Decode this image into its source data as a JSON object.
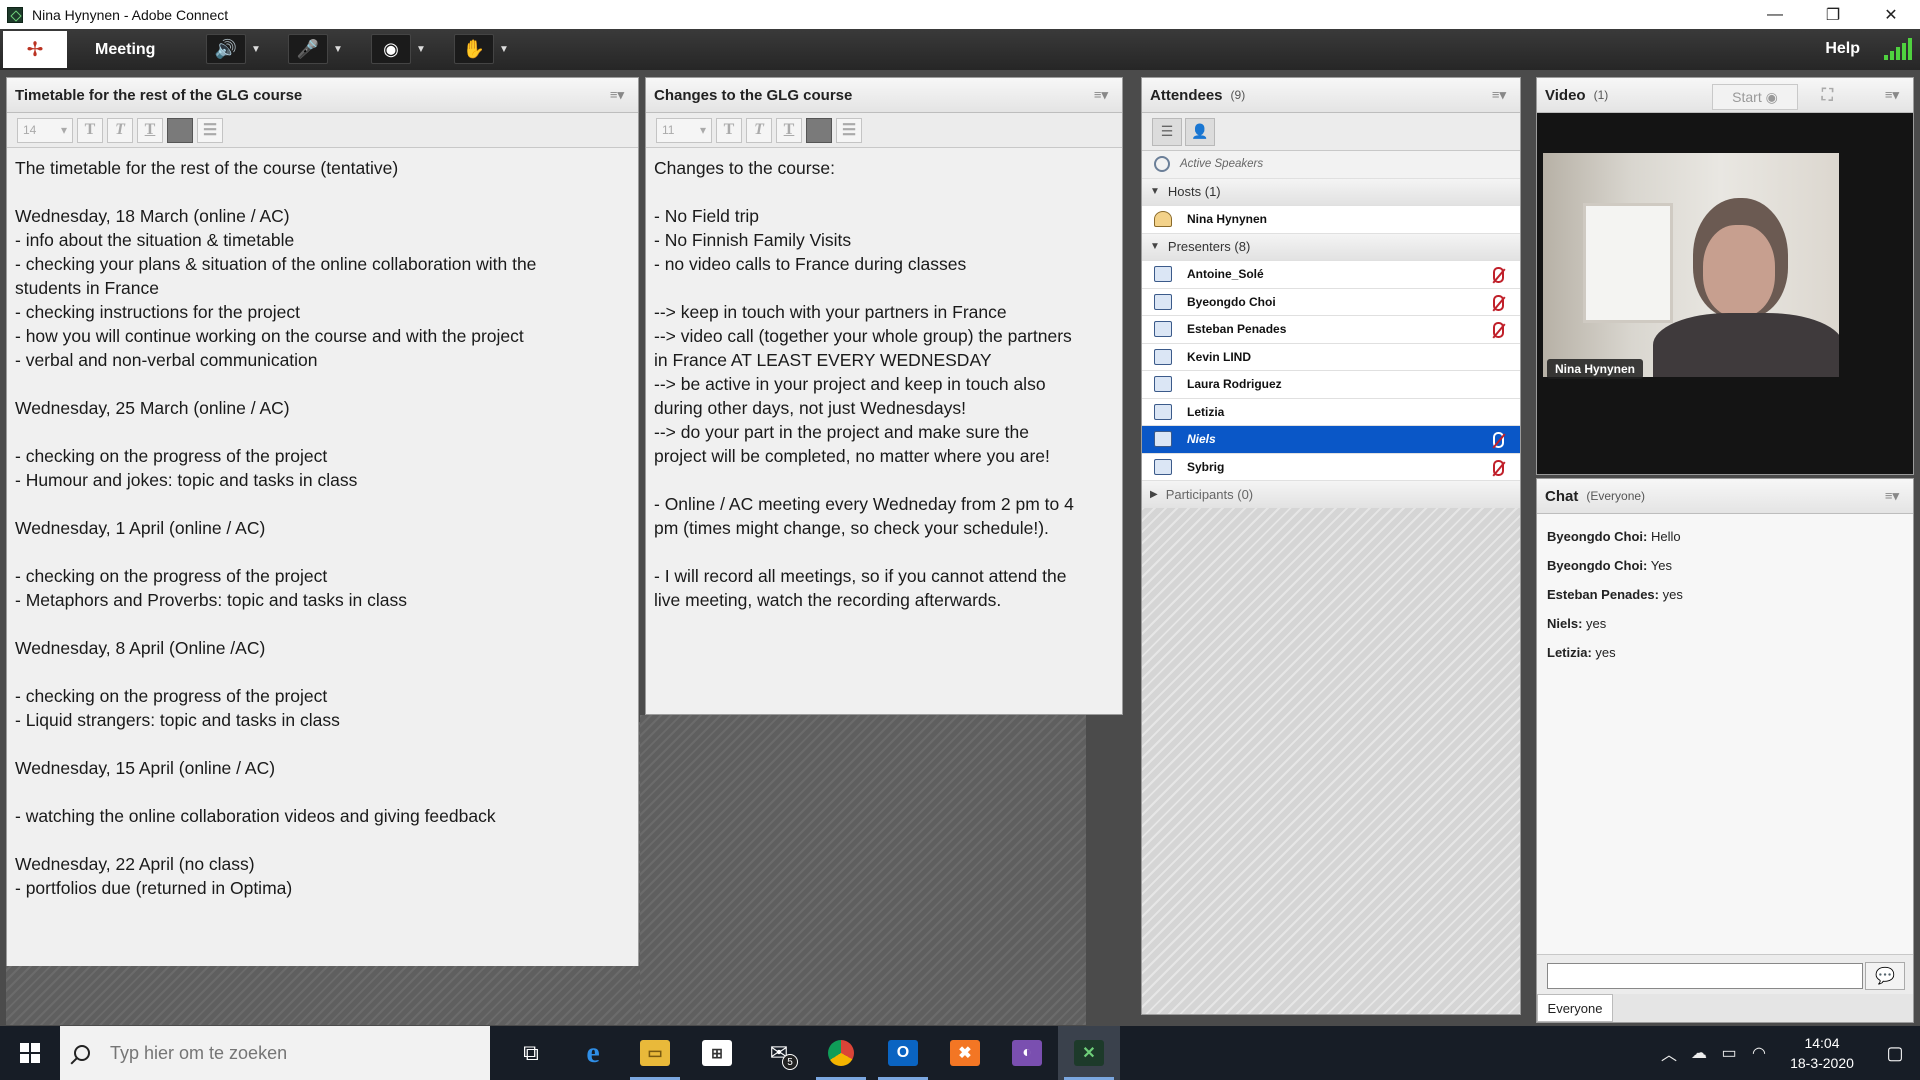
{
  "window": {
    "title": "Nina Hynynen - Adobe Connect",
    "controls": [
      "—",
      "❐",
      "✕"
    ]
  },
  "toolbar": {
    "meeting_label": "Meeting",
    "help_label": "Help"
  },
  "timetable_pod": {
    "title": "Timetable for the rest of the GLG course",
    "font_size": "14",
    "lines": [
      "The timetable for the rest of the course (tentative)",
      "",
      "Wednesday, 18 March (online / AC)",
      "- info about the situation & timetable",
      "- checking your plans & situation of the online collaboration with the",
      "students in France",
      "- checking instructions for the project",
      "- how you will continue working on the course and with the project",
      "- verbal and non-verbal communication",
      "",
      "Wednesday, 25 March (online / AC)",
      "",
      "- checking on the progress of the project",
      "- Humour and jokes: topic and tasks in class",
      "",
      "Wednesday, 1 April (online / AC)",
      "",
      "- checking on the progress of the project",
      "- Metaphors and Proverbs: topic and tasks in class",
      "",
      "Wednesday, 8 April (Online /AC)",
      "",
      "- checking on the progress of the project",
      "- Liquid strangers: topic and tasks in class",
      "",
      "Wednesday, 15 April (online / AC)",
      "",
      "- watching the online collaboration videos and giving feedback",
      "",
      "Wednesday, 22 April (no class)",
      "- portfolios due (returned in Optima)"
    ]
  },
  "changes_pod": {
    "title": "Changes to the GLG course",
    "font_size": "11",
    "lines": [
      "Changes to the course:",
      "",
      "- No Field trip",
      "- No Finnish Family Visits",
      "- no video calls to France during classes",
      "",
      "--> keep in touch with your partners in France",
      "--> video call (together your whole group) the partners",
      "in France AT LEAST EVERY WEDNESDAY",
      "--> be active in your project and keep in touch also",
      "during other days, not just Wednesdays!",
      "--> do your part in the project and make sure the",
      "project will be completed, no matter where you are!",
      "",
      "- Online / AC meeting every Wedneday from 2 pm to 4",
      "pm (times might change, so check your schedule!).",
      "",
      "- I will record all meetings, so if you cannot attend the",
      "live meeting, watch the recording afterwards."
    ]
  },
  "attendees_pod": {
    "title": "Attendees",
    "count": "(9)",
    "active_speakers": "Active Speakers",
    "hosts_label": "Hosts (1)",
    "hosts": [
      "Nina Hynynen"
    ],
    "presenters_label": "Presenters (8)",
    "presenters": [
      {
        "name": "Antoine_Solé",
        "mic": true
      },
      {
        "name": "Byeongdo Choi",
        "mic": true
      },
      {
        "name": "Esteban Penades",
        "mic": true
      },
      {
        "name": "Kevin LIND",
        "mic": false
      },
      {
        "name": "Laura Rodriguez",
        "mic": false
      },
      {
        "name": "Letizia",
        "mic": false
      },
      {
        "name": "Niels",
        "mic": true,
        "selected": true
      },
      {
        "name": "Sybrig",
        "mic": true
      }
    ],
    "participants_label": "Participants (0)"
  },
  "video_pod": {
    "title": "Video",
    "count": "(1)",
    "start_label": "Start",
    "video_name": "Nina Hynynen"
  },
  "chat_pod": {
    "title": "Chat",
    "audience": "(Everyone)",
    "messages": [
      {
        "sender": "Byeongdo Choi:",
        "text": "Hello"
      },
      {
        "sender": "Byeongdo Choi:",
        "text": "Yes"
      },
      {
        "sender": "Esteban Penades:",
        "text": "yes"
      },
      {
        "sender": "Niels:",
        "text": "yes"
      },
      {
        "sender": "Letizia:",
        "text": "yes"
      }
    ],
    "input_value": "",
    "tab_label": "Everyone"
  },
  "taskbar": {
    "search_placeholder": "Typ hier om te zoeken",
    "mail_badge": "5",
    "time": "14:04",
    "date": "18-3-2020"
  }
}
